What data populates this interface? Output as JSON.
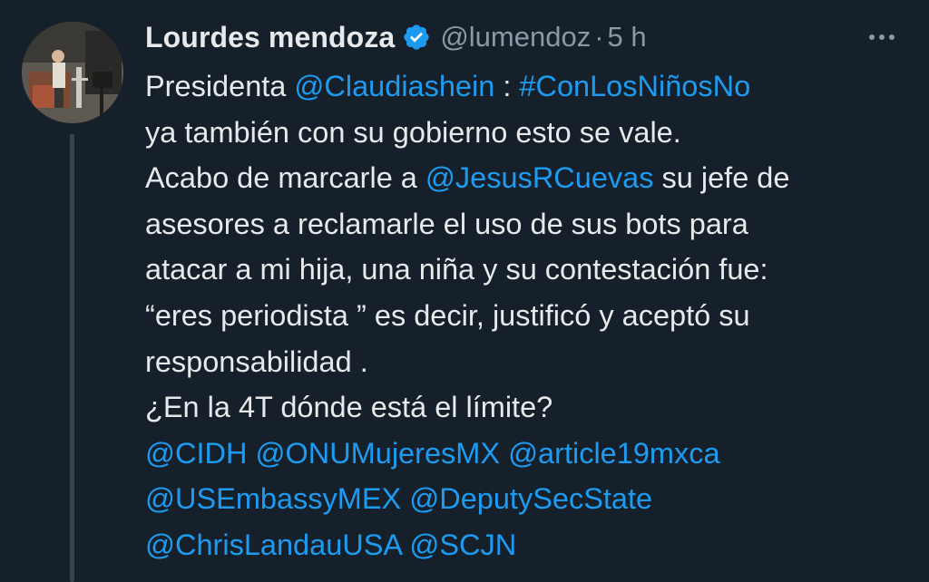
{
  "author": {
    "display_name": "Lourdes mendoza",
    "handle": "@lumendoz",
    "separator": "·",
    "time": "5 h"
  },
  "colors": {
    "background": "#15202b",
    "text": "#e7e9ea",
    "secondary": "#8b98a5",
    "link": "#1d9bf0",
    "verified_badge": "#1d9bf0"
  },
  "icons": {
    "verified": "verified-badge-icon",
    "more": "more-options-icon"
  },
  "tweet": {
    "l1": {
      "a": "Presidenta ",
      "b": "@Claudiashein",
      "c": " : ",
      "d": "#ConLosNiñosNo"
    },
    "l2": "ya también con su gobierno esto se vale.",
    "l3": {
      "a": "Acabo de marcarle a ",
      "b": "@JesusRCuevas",
      "c": " su jefe de"
    },
    "l4": "asesores a reclamarle el uso de sus bots  para",
    "l5": "atacar a mi hija, una niña y su contestación fue:",
    "l6": "“eres periodista ”  es decir, justificó y aceptó su",
    "l7": "responsabilidad .",
    "l8": "¿En la 4T dónde está el límite?",
    "l9": {
      "a": "@CIDH",
      "b": " ",
      "c": "@ONUMujeresMX",
      "d": " ",
      "e": "@article19mxca"
    },
    "l10": {
      "a": "@USEmbassyMEX",
      "b": " ",
      "c": "@DeputySecState"
    },
    "l11": {
      "a": "@ChrisLandauUSA",
      "b": " ",
      "c": "@SCJN"
    }
  }
}
